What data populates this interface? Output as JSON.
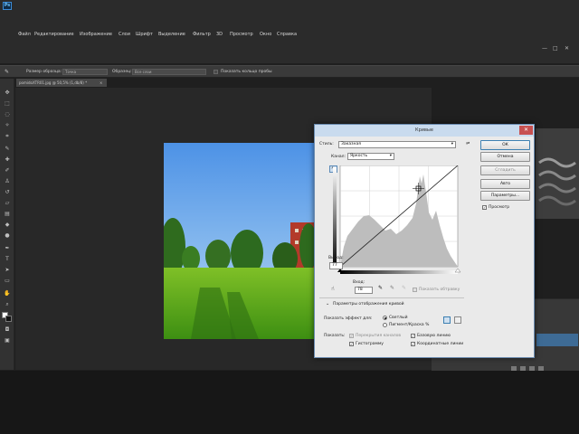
{
  "app": {
    "logo": "Ps"
  },
  "menu": [
    "Файл",
    "Редактирование",
    "Изображение",
    "Слои",
    "Шрифт",
    "Выделение",
    "Фильтр",
    "3D",
    "Просмотр",
    "Окно",
    "Справка"
  ],
  "window_controls": {
    "minimize": "—",
    "maximize": "□",
    "close": "✕"
  },
  "options": {
    "sample_size_label": "Размер образца:",
    "sample_size_value": "Точка",
    "sample_label": "Образец:",
    "sample_value": "Все слои",
    "show_ring_label": "Показать кольцо пробы"
  },
  "document": {
    "tab_title": "pomidoXTR01.jpg @ 50,5% (1,db/8) *",
    "tab_close": "×"
  },
  "dialog": {
    "title": "Кривые",
    "close": "✕",
    "preset_label": "Стиль:",
    "preset_value": "Заказная",
    "channel_label": "Канал:",
    "channel_value": "Яркость",
    "output_label": "Выход:",
    "output_value": "77",
    "input_label": "Вход:",
    "input_value": "78",
    "show_clipping_label": "Показать обтравку",
    "display_options_label": "Параметры отображения кривой",
    "show_amount_label": "Показать эффект для:",
    "light_label": "Светлый",
    "pigment_label": "Пигмент/Краска %",
    "show_label": "Показать:",
    "channel_overlays_label": "Перекрытия каналов",
    "baseline_label": "Базовую линию",
    "histogram_label": "Гистограмму",
    "intersection_label": "Координатные линии",
    "ok": "ОК",
    "cancel": "Отмена",
    "smooth": "Сгладить",
    "auto": "Авто",
    "options": "Параметры...",
    "preview_label": "Просмотр",
    "preview_checked": true,
    "curve_point": {
      "input": 78,
      "output": 77
    }
  },
  "colors": {
    "accent": "#3c7fb1",
    "panel_bg": "#2b2b2b",
    "dialog_bg": "#eaeaea"
  }
}
